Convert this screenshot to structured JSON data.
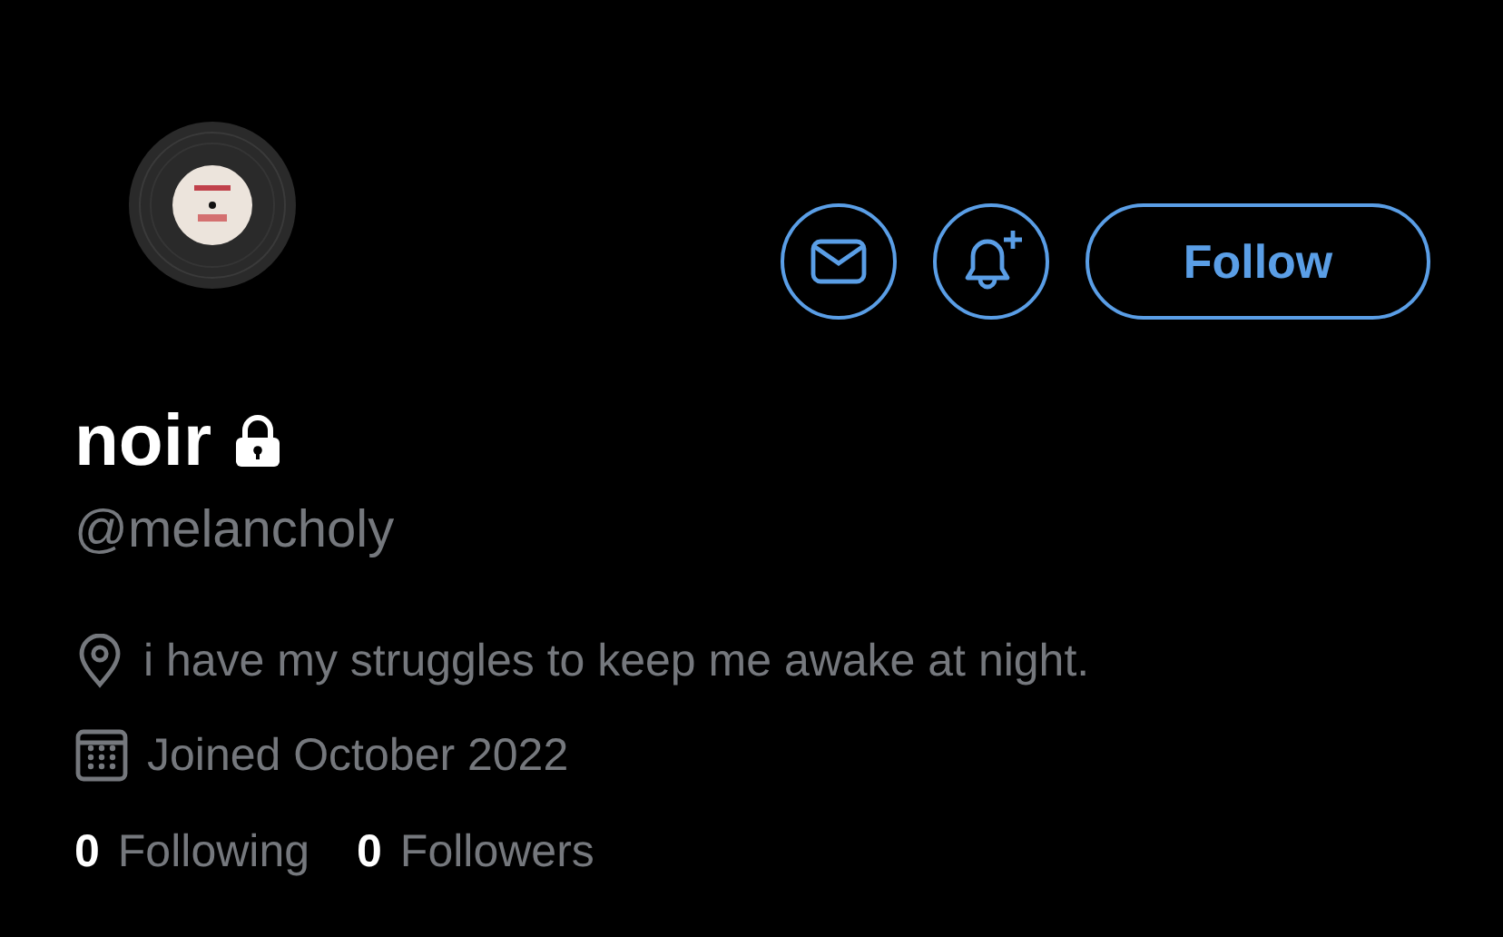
{
  "profile": {
    "name": "noir",
    "protected": true,
    "handle": "@melancholy"
  },
  "actions": {
    "follow_label": "Follow"
  },
  "details": [
    {
      "kind": "location",
      "text": "i have my struggles to keep me awake at night."
    },
    {
      "kind": "joined",
      "text": "Joined October 2022"
    }
  ],
  "stats": [
    {
      "count": "0",
      "label": "Following"
    },
    {
      "count": "0",
      "label": "Followers"
    }
  ]
}
